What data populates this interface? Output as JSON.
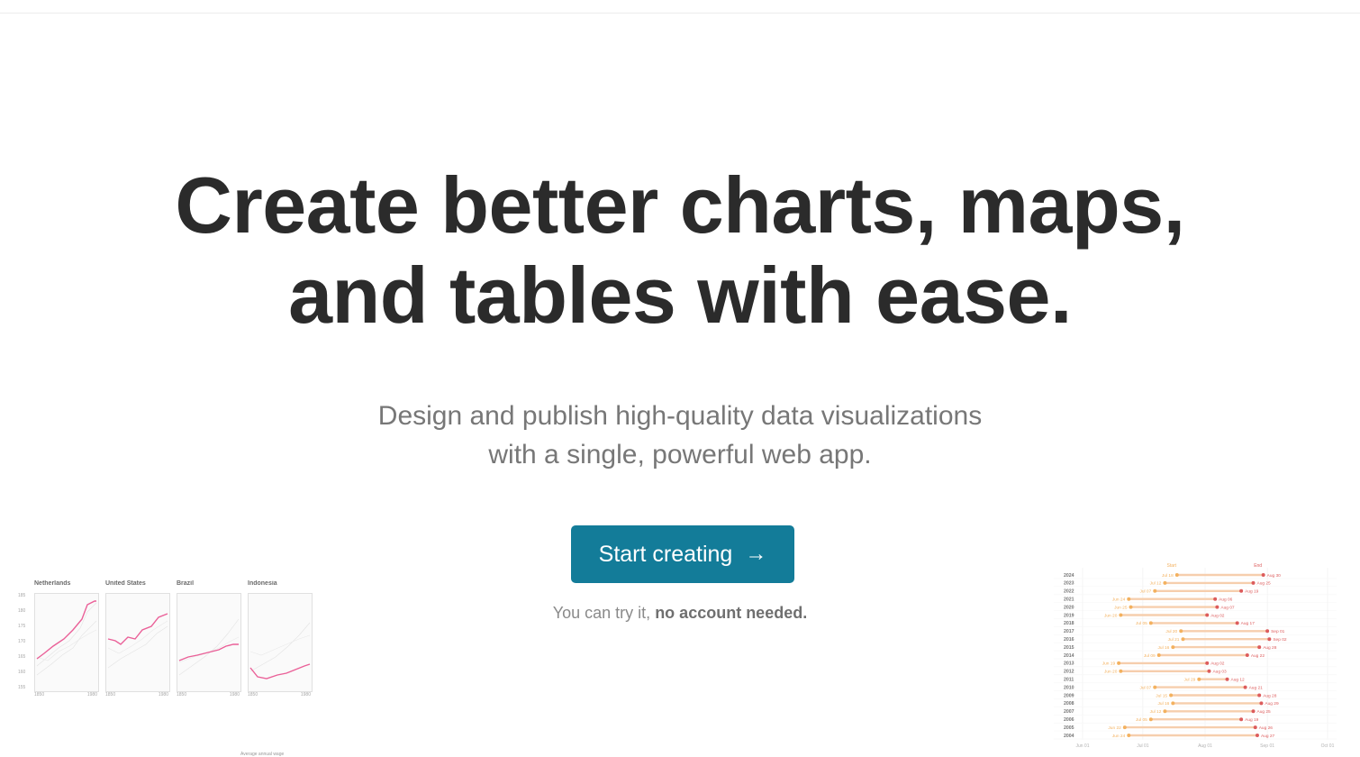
{
  "hero": {
    "headline_line1": "Create better charts, maps,",
    "headline_line2": "and tables with ease.",
    "subline_line1": "Design and publish high-quality data visualizations",
    "subline_line2": "with a single, powerful web app."
  },
  "cta": {
    "label": "Start creating",
    "arrow_icon": "→"
  },
  "note": {
    "prefix": "You can try it, ",
    "bold": "no account needed."
  },
  "multiples": {
    "panels": [
      {
        "title": "Netherlands"
      },
      {
        "title": "United States"
      },
      {
        "title": "Brazil"
      },
      {
        "title": "Indonesia"
      }
    ],
    "x_ticks": [
      "1850",
      "1980"
    ],
    "y_ticks": [
      "185",
      "180",
      "175",
      "170",
      "165",
      "160",
      "155"
    ],
    "footer_label": "Average annual wage"
  },
  "chart_data": {
    "type": "dumbbell",
    "start_label": "Start",
    "end_label": "End",
    "x_ticks": [
      "Jun 01",
      "Jul 01",
      "Aug 01",
      "Sep 01",
      "Oct 01"
    ],
    "rows": [
      {
        "year": "2024",
        "start": "Jul 18",
        "end": "Aug 30"
      },
      {
        "year": "2023",
        "start": "Jul 12",
        "end": "Aug 25"
      },
      {
        "year": "2022",
        "start": "Jul 07",
        "end": "Aug 19"
      },
      {
        "year": "2021",
        "start": "Jun 24",
        "end": "Aug 06"
      },
      {
        "year": "2020",
        "start": "Jun 25",
        "end": "Aug 07"
      },
      {
        "year": "2019",
        "start": "Jun 20",
        "end": "Aug 02"
      },
      {
        "year": "2018",
        "start": "Jul 05",
        "end": "Aug 17"
      },
      {
        "year": "2017",
        "start": "Jul 20",
        "end": "Sep 01"
      },
      {
        "year": "2016",
        "start": "Jul 21",
        "end": "Sep 02"
      },
      {
        "year": "2015",
        "start": "Jul 16",
        "end": "Aug 28"
      },
      {
        "year": "2014",
        "start": "Jul 09",
        "end": "Aug 22"
      },
      {
        "year": "2013",
        "start": "Jun 19",
        "end": "Aug 02"
      },
      {
        "year": "2012",
        "start": "Jun 20",
        "end": "Aug 03"
      },
      {
        "year": "2011",
        "start": "Jul 29",
        "end": "Aug 12"
      },
      {
        "year": "2010",
        "start": "Jul 07",
        "end": "Aug 21"
      },
      {
        "year": "2009",
        "start": "Jul 15",
        "end": "Aug 28"
      },
      {
        "year": "2008",
        "start": "Jul 16",
        "end": "Aug 29"
      },
      {
        "year": "2007",
        "start": "Jul 12",
        "end": "Aug 25"
      },
      {
        "year": "2006",
        "start": "Jul 05",
        "end": "Aug 19"
      },
      {
        "year": "2005",
        "start": "Jun 22",
        "end": "Aug 26"
      },
      {
        "year": "2004",
        "start": "Jun 24",
        "end": "Aug 27"
      }
    ]
  },
  "colors": {
    "accent": "#137c99",
    "headline": "#2b2b2b",
    "start": "#f2a94e",
    "end": "#d94b4b"
  }
}
